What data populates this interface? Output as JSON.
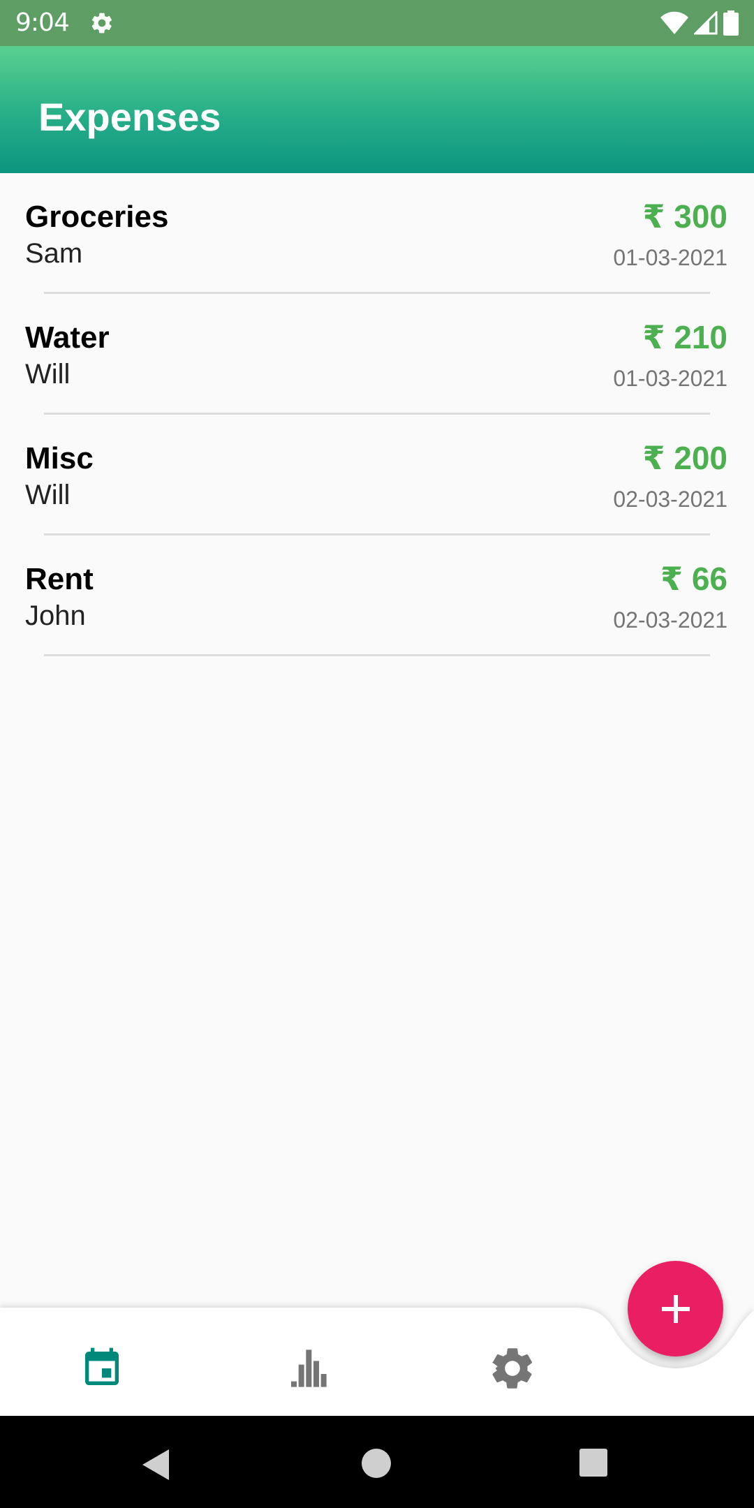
{
  "status_bar": {
    "time": "9:04",
    "icons": [
      "settings-icon",
      "wifi-icon",
      "signal-icon",
      "battery-icon"
    ]
  },
  "app_bar": {
    "title": "Expenses"
  },
  "expenses": [
    {
      "title": "Groceries",
      "person": "Sam",
      "amount": "₹ 300",
      "date": "01-03-2021"
    },
    {
      "title": "Water",
      "person": "Will",
      "amount": "₹ 210",
      "date": "01-03-2021"
    },
    {
      "title": "Misc",
      "person": "Will",
      "amount": "₹ 200",
      "date": "02-03-2021"
    },
    {
      "title": "Rent",
      "person": "John",
      "amount": "₹ 66",
      "date": "02-03-2021"
    }
  ],
  "bottom_nav": {
    "items": [
      {
        "icon": "calendar-icon",
        "active": true
      },
      {
        "icon": "bar-chart-icon",
        "active": false
      },
      {
        "icon": "settings-icon",
        "active": false
      }
    ]
  },
  "fab": {
    "icon": "plus-icon"
  },
  "system_nav": {
    "icons": [
      "back-icon",
      "home-icon",
      "recents-icon"
    ]
  },
  "colors": {
    "status_bar": "#5e9e64",
    "app_bar_top": "#5ad090",
    "app_bar_bottom": "#0c9580",
    "amount": "#4caf50",
    "fab": "#e91e63",
    "nav_active": "#00897b",
    "nav_inactive": "#757575"
  }
}
